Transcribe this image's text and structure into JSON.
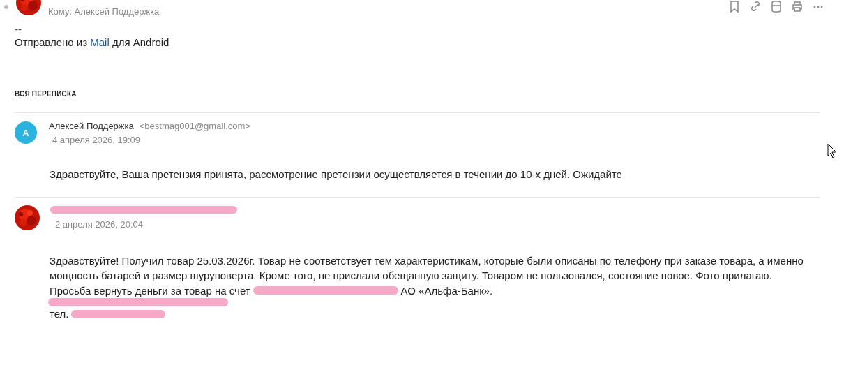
{
  "header": {
    "to": "Кому: Алексей Поддержка",
    "actions": [
      {
        "kind": "bookmark"
      },
      {
        "kind": "link"
      },
      {
        "kind": "archive"
      },
      {
        "kind": "print"
      },
      {
        "kind": "more"
      }
    ]
  },
  "signature": {
    "dashes": "--",
    "before": "Отправлено из",
    "link": "Mail",
    "after": "для Android"
  },
  "thread_label": "ВСЯ ПЕРЕПИСКА",
  "messages": [
    {
      "avatar": {
        "kind": "letter",
        "letter": "A"
      },
      "sender": [
        {
          "kind": "text",
          "text": "Алексей Поддержка"
        }
      ],
      "email": "<bestmag001@gmail.com>",
      "date": "4 апреля 2026, 19:09",
      "body": [
        [
          {
            "kind": "text",
            "text": "Здравствуйте, Ваша претензия принята, рассмотрение претензии осуществляется в течении до 10-х дней. Ожидайте"
          }
        ]
      ]
    },
    {
      "avatar": {
        "kind": "picture"
      },
      "sender": [
        {
          "kind": "redacted"
        }
      ],
      "date": "2 апреля 2026, 20:04",
      "body": [
        [
          {
            "kind": "text",
            "text": "Здравствуйте! Получил товар 25.03.2026г. Товар не соответствует тем характеристикам, которые были описаны по телефону при заказе товара, а именно мощность батарей и размер шуруповерта. Кроме того, не прислали обещанную защиту. Товаром не пользовался, состояние новое. Фото прилагаю."
          }
        ],
        [
          {
            "kind": "text",
            "text": "Просьба вернуть деньги за товар на счет"
          },
          {
            "kind": "redacted"
          },
          {
            "kind": "text",
            "text": "АО «Альфа-Банк»."
          }
        ],
        [
          {
            "kind": "redacted"
          }
        ],
        [
          {
            "kind": "text",
            "text": "тел."
          },
          {
            "kind": "redacted"
          }
        ]
      ]
    }
  ]
}
